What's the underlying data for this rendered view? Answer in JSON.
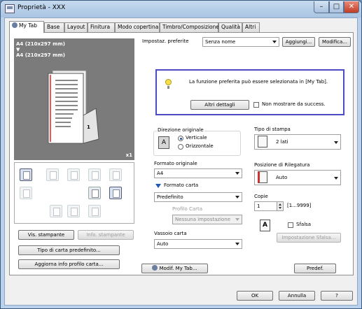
{
  "window": {
    "title": "Proprietà - XXX",
    "min_glyph": "–",
    "max_glyph": "□",
    "close_glyph": "✕"
  },
  "tabs": [
    {
      "label": "My Tab",
      "active": true
    },
    {
      "label": "Base"
    },
    {
      "label": "Layout"
    },
    {
      "label": "Finitura"
    },
    {
      "label": "Modo copertina"
    },
    {
      "label": "Timbro/Composizione"
    },
    {
      "label": "Qualità"
    },
    {
      "label": "Altri"
    }
  ],
  "preview": {
    "paper_line1": "A4 (210x297 mm)",
    "paper_arrow": "▼",
    "paper_line2": "A4 (210x297 mm)",
    "page_number": "1",
    "copies_label": "x1"
  },
  "left_buttons": {
    "vis_stampante": "Vis. stampante",
    "info_stampante": "Info. stampante",
    "tipo_carta_predefinito": "Tipo di carta predefinito...",
    "aggiorna_info_profilo": "Aggiorna info profilo carta..."
  },
  "favorites": {
    "label": "Impostaz. preferite",
    "value": "Senza nome",
    "add_button": "Aggiungi...",
    "modify_button": "Modifica..."
  },
  "info": {
    "message": "La funzione preferita può essere selezionata in [My Tab].",
    "details_button": "Altri dettagli",
    "checkbox_label": "Non mostrare da success."
  },
  "orientation": {
    "group_label": "Direzione originale",
    "icon_letter": "A",
    "vertical": "Verticale",
    "horizontal": "Orizzontale"
  },
  "original_size": {
    "label": "Formato originale",
    "value": "A4"
  },
  "paper_size": {
    "label": "Formato carta",
    "value": "Predefinito"
  },
  "paper_profile": {
    "label": "Profilo Carta",
    "value": "Nessuna impostazione"
  },
  "paper_tray": {
    "label": "Vassoio carta",
    "value": "Auto"
  },
  "print_type": {
    "label": "Tipo di stampa",
    "value": "2 lati"
  },
  "binding_position": {
    "label": "Posizione di Rilegatura",
    "value": "Auto"
  },
  "copies": {
    "label": "Copie",
    "value": "1",
    "range": "[1...9999]"
  },
  "offset": {
    "checkbox_label": "Sfalsa",
    "settings_button": "Impostazione Sfalsa...",
    "icon_letter": "A"
  },
  "footer_pane": {
    "modify_mytab_button": "Modif. My Tab...",
    "default_button": "Predef."
  },
  "dialog_buttons": {
    "ok": "OK",
    "cancel": "Annulla",
    "help": "?"
  }
}
